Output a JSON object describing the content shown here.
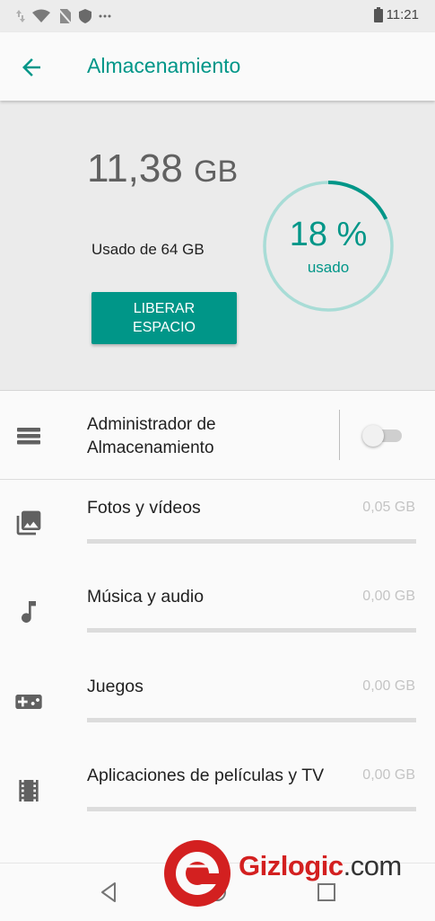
{
  "status_bar": {
    "time": "11:21",
    "icons": [
      "data-arrows-icon",
      "wifi-icon",
      "no-sim-icon",
      "shield-icon",
      "more-dots-icon",
      "battery-icon"
    ]
  },
  "app_bar": {
    "title": "Almacenamiento",
    "back_icon": "arrow-back-icon"
  },
  "summary": {
    "used_value": "11,38",
    "used_unit": "GB",
    "used_of": "Usado de 64 GB",
    "free_button": "LIBERAR ESPACIO",
    "percent_text": "18 %",
    "percent_label": "usado",
    "percent_value": 0.18
  },
  "manager": {
    "label": "Administrador de Almacenamiento",
    "icon": "storage-manager-icon",
    "enabled": false
  },
  "categories": [
    {
      "label": "Fotos y vídeos",
      "size": "0,05 GB",
      "icon": "photo-library-icon",
      "fraction": 0.0
    },
    {
      "label": "Música y audio",
      "size": "0,00 GB",
      "icon": "music-note-icon",
      "fraction": 0.0
    },
    {
      "label": "Juegos",
      "size": "0,00 GB",
      "icon": "gamepad-icon",
      "fraction": 0.0
    },
    {
      "label": "Aplicaciones de películas y TV",
      "size": "0,00 GB",
      "icon": "movie-icon",
      "fraction": 0.0
    }
  ],
  "nav_bar": {
    "icons": [
      "back-triangle-icon",
      "home-circle-icon",
      "recents-square-icon"
    ]
  },
  "watermark": {
    "brand": "Gizlogic",
    "tld": ".com"
  },
  "colors": {
    "accent": "#009688",
    "ring_track": "#a8dcd6",
    "watermark_red": "#d32020"
  }
}
